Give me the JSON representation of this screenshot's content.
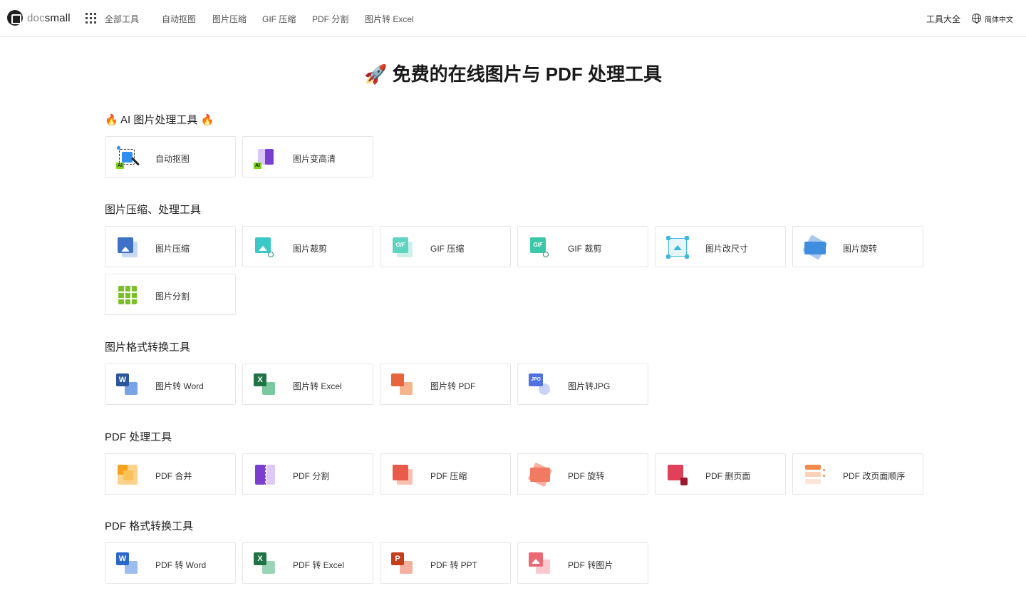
{
  "header": {
    "logo_part1": "doc",
    "logo_part2": "small",
    "nav_all": "全部工具",
    "nav": [
      "自动抠图",
      "图片压缩",
      "GIF 压缩",
      "PDF 分割",
      "图片转 Excel"
    ],
    "tools_all": "工具大全",
    "language": "简体中文"
  },
  "page_title": "🚀 免费的在线图片与 PDF 处理工具",
  "sections": {
    "ai": {
      "title": "🔥 AI 图片处理工具 🔥",
      "items": [
        {
          "label": "自动抠图",
          "icon": "ai-cutout-icon"
        },
        {
          "label": "图片变高清",
          "icon": "ai-enhance-icon"
        }
      ]
    },
    "image": {
      "title": "图片压缩、处理工具",
      "items": [
        {
          "label": "图片压缩",
          "icon": "image-compress-icon"
        },
        {
          "label": "图片裁剪",
          "icon": "image-crop-icon"
        },
        {
          "label": "GIF 压缩",
          "icon": "gif-compress-icon"
        },
        {
          "label": "GIF 裁剪",
          "icon": "gif-crop-icon"
        },
        {
          "label": "图片改尺寸",
          "icon": "image-resize-icon"
        },
        {
          "label": "图片旋转",
          "icon": "image-rotate-icon"
        },
        {
          "label": "图片分割",
          "icon": "image-split-icon"
        }
      ]
    },
    "image_convert": {
      "title": "图片格式转换工具",
      "items": [
        {
          "label": "图片转 Word",
          "icon": "image-to-word-icon"
        },
        {
          "label": "图片转 Excel",
          "icon": "image-to-excel-icon"
        },
        {
          "label": "图片转 PDF",
          "icon": "image-to-pdf-icon"
        },
        {
          "label": "图片转JPG",
          "icon": "image-to-jpg-icon"
        }
      ]
    },
    "pdf": {
      "title": "PDF 处理工具",
      "items": [
        {
          "label": "PDF 合并",
          "icon": "pdf-merge-icon"
        },
        {
          "label": "PDF 分割",
          "icon": "pdf-split-icon"
        },
        {
          "label": "PDF 压缩",
          "icon": "pdf-compress-icon"
        },
        {
          "label": "PDF 旋转",
          "icon": "pdf-rotate-icon"
        },
        {
          "label": "PDF 删页面",
          "icon": "pdf-delete-page-icon"
        },
        {
          "label": "PDF 改页面顺序",
          "icon": "pdf-reorder-icon"
        }
      ]
    },
    "pdf_convert": {
      "title": "PDF 格式转换工具",
      "items": [
        {
          "label": "PDF 转 Word",
          "icon": "pdf-to-word-icon"
        },
        {
          "label": "PDF 转 Excel",
          "icon": "pdf-to-excel-icon"
        },
        {
          "label": "PDF 转 PPT",
          "icon": "pdf-to-ppt-icon"
        },
        {
          "label": "PDF 转图片",
          "icon": "pdf-to-image-icon"
        }
      ]
    }
  },
  "icon_text": {
    "ai": "AI",
    "gif": "GIF",
    "word": "W",
    "excel": "X",
    "jpg": "JPG",
    "ppt": "P"
  },
  "colors": {
    "word": "#2b579a",
    "excel": "#217346",
    "pdf": "#e8643c",
    "ppt": "#c43e1c",
    "teal": "#3cc8c8",
    "blue": "#3f72c6",
    "purple": "#7b3fd0",
    "green": "#7cbf2a"
  }
}
